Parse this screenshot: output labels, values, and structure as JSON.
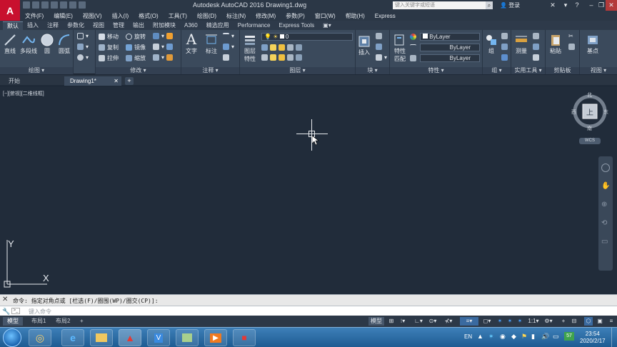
{
  "app": {
    "title": "Autodesk AutoCAD 2016    Drawing1.dwg",
    "logo_letter": "A",
    "search_placeholder": "键入关键字或短语",
    "login_label": "登录",
    "accent": "#c8102e"
  },
  "menu": [
    "文件(F)",
    "编辑(E)",
    "视图(V)",
    "插入(I)",
    "格式(O)",
    "工具(T)",
    "绘图(D)",
    "标注(N)",
    "修改(M)",
    "参数(P)",
    "窗口(W)",
    "帮助(H)",
    "Express"
  ],
  "ribbon_tabs": [
    "默认",
    "插入",
    "注释",
    "参数化",
    "视图",
    "管理",
    "输出",
    "附加模块",
    "A360",
    "精选应用",
    "Performance",
    "Express Tools"
  ],
  "ribbon_active_tab": "默认",
  "panels": {
    "draw": {
      "label": "绘图",
      "tools": [
        "直线",
        "多段线",
        "圆",
        "圆弧"
      ]
    },
    "modify": {
      "label": "修改",
      "tools": [
        "移动",
        "旋转",
        "复制",
        "镜像",
        "拉伸",
        "缩放"
      ]
    },
    "annotation": {
      "label": "注释",
      "tools": [
        "文字",
        "标注"
      ]
    },
    "layers": {
      "label": "图层",
      "tool": "图层\n特性",
      "tool_line1": "图层",
      "tool_line2": "特性",
      "current_layer": "0"
    },
    "block": {
      "label": "块",
      "tool": "插入"
    },
    "properties": {
      "label": "特性",
      "tool_line1": "特性",
      "tool_line2": "匹配",
      "color": "ByLayer",
      "linetype": "ByLayer",
      "lineweight": "ByLayer"
    },
    "groups": {
      "label": "组",
      "tool": "组"
    },
    "utilities": {
      "label": "实用工具",
      "tool": "测量"
    },
    "clipboard": {
      "label": "剪贴板",
      "tool": "粘贴"
    },
    "view": {
      "label": "视图",
      "tool": "基点"
    }
  },
  "doc_tabs": {
    "start": "开始",
    "drawing": "Drawing1*"
  },
  "viewport": {
    "label": "[−][俯视][二维线框]",
    "viewcube_face": "上",
    "compass": {
      "north": "北",
      "south": "南",
      "east": "东",
      "west": "西"
    },
    "wcs_label": "WCS",
    "ucs_x": "X",
    "ucs_y": "Y"
  },
  "command": {
    "history": "命令: 指定对角点或 [栏选(F)/圈围(WP)/圈交(CP)]:",
    "placeholder": "键入命令"
  },
  "layout_tabs": [
    "模型",
    "布局1",
    "布局2"
  ],
  "status": {
    "model_label": "模型",
    "scale": "1:1"
  },
  "taskbar": {
    "ime": "EN",
    "time": "23:54",
    "date": "2020/2/17",
    "tray_badge": "57"
  }
}
